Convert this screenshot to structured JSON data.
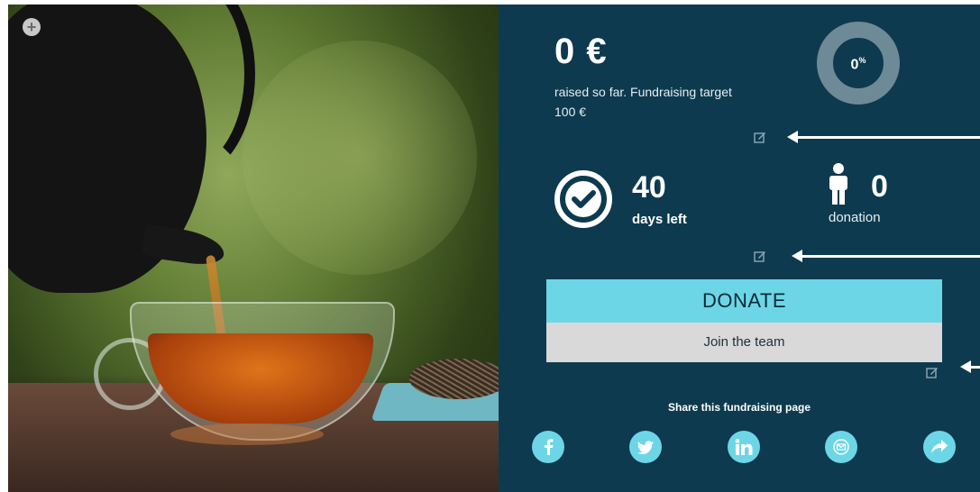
{
  "campaign": {
    "amount_raised": "0 €",
    "raised_text": "raised so far. Fundraising target 100 €",
    "progress_percent": "0",
    "progress_symbol": "%",
    "progress_fraction": 0,
    "days_left_value": "40",
    "days_left_label": "days left",
    "donations_value": "0",
    "donations_label": "donation"
  },
  "actions": {
    "donate_label": "DONATE",
    "join_label": "Join the team"
  },
  "share": {
    "title": "Share this fundraising page",
    "networks": [
      "facebook",
      "twitter",
      "linkedin",
      "email",
      "forward"
    ]
  },
  "colors": {
    "panel_bg": "#0d3a4f",
    "accent": "#6dd6e6",
    "ring": "#6f8a97",
    "join_bg": "#d9d9d9"
  },
  "icons": {
    "add": "plus-icon",
    "edit": "edit-icon",
    "clock": "clock-check-icon",
    "person": "person-icon"
  }
}
